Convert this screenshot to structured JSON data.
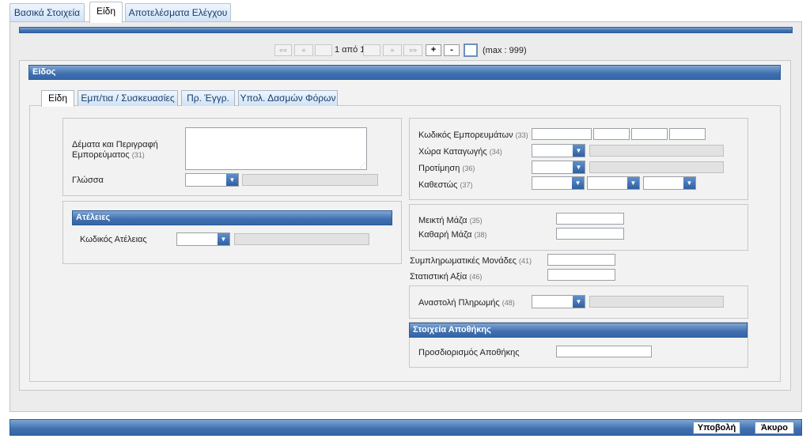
{
  "top_tabs": [
    {
      "label": "Βασικά Στοιχεία"
    },
    {
      "label": "Είδη"
    },
    {
      "label": "Αποτελέσματα Ελέγχου"
    }
  ],
  "pager": {
    "first": "«« ",
    "prev": "«",
    "page_text": "1 από 1",
    "next": "»",
    "last": "»»",
    "add": "+",
    "remove": "-",
    "max_text": "(max : 999)"
  },
  "section_title": "Είδος",
  "sub_tabs": [
    {
      "label": "Είδη"
    },
    {
      "label": "Εμπ/τια / Συσκευασίες"
    },
    {
      "label": "Πρ. Έγγρ."
    },
    {
      "label": "Υπολ. Δασμών Φόρων"
    }
  ],
  "left": {
    "description_label": "Δέματα και Περιγραφή",
    "description_label2": "Εμπορεύματος",
    "description_num": "(31)",
    "language_label": "Γλώσσα",
    "exemptions_title": "Ατέλειες",
    "exemption_code_label": "Κωδικός Ατέλειας"
  },
  "right": {
    "commodity_code_label": "Κωδικός Εμπορευμάτων",
    "commodity_code_num": "(33)",
    "origin_label": "Χώρα Καταγωγής",
    "origin_num": "(34)",
    "preference_label": "Προτίμηση",
    "preference_num": "(36)",
    "regime_label": "Καθεστώς",
    "regime_num": "(37)",
    "gross_mass_label": "Μεικτή Μάζα",
    "gross_mass_num": "(35)",
    "net_mass_label": "Καθαρή Μάζα",
    "net_mass_num": "(38)",
    "supp_units_label": "Συμπληρωματικές Μονάδες",
    "supp_units_num": "(41)",
    "stat_value_label": "Στατιστική Αξία",
    "stat_value_num": "(46)",
    "payment_suspension_label": "Αναστολή Πληρωμής",
    "payment_suspension_num": "(48)",
    "warehouse_title": "Στοιχεία Αποθήκης",
    "warehouse_id_label": "Προσδιορισμός Αποθήκης"
  },
  "footer": {
    "submit": "Υποβολή",
    "cancel": "Άκυρο"
  },
  "colors": {
    "header_blue": "#3f6fae",
    "panel_gray": "#ececec"
  }
}
